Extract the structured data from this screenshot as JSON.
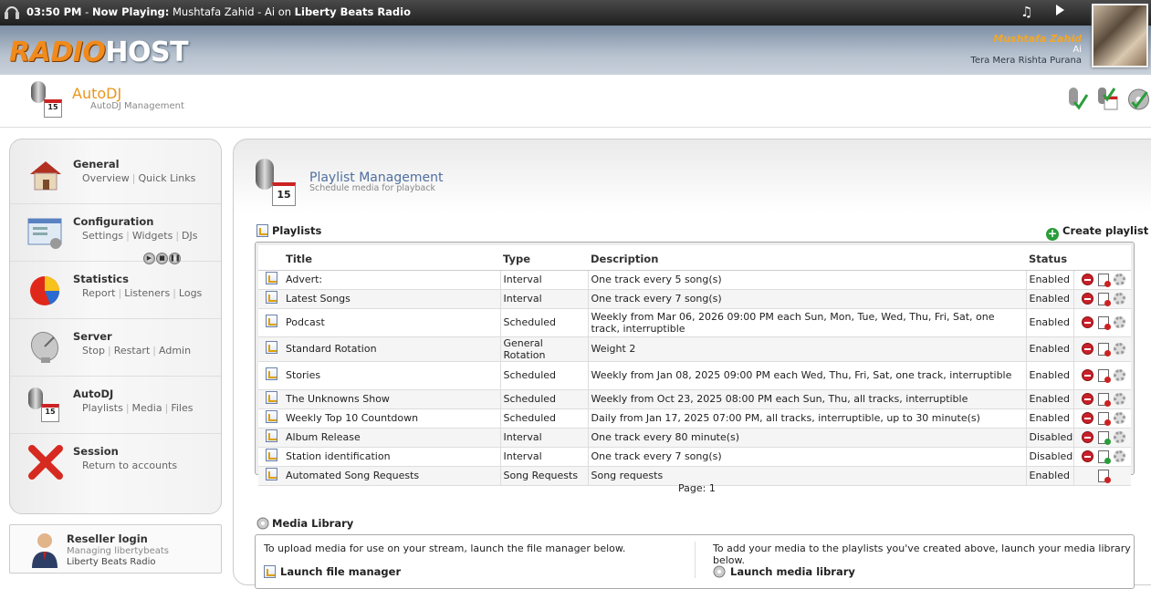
{
  "topbar": {
    "time": "03:50 PM",
    "now_playing_label": "Now Playing:",
    "track": "Mushtafa Zahid - Ai",
    "on": "on",
    "station": "Liberty Beats Radio"
  },
  "brand": {
    "part1": "RADIO",
    "part2": "HOST"
  },
  "now_playing": {
    "artist": "Mushtafa Zahid",
    "title": "Ai",
    "album": "Tera Mera Rishta Purana"
  },
  "page": {
    "title": "AutoDJ",
    "subtitle": "AutoDJ Management"
  },
  "sidebar": {
    "items": [
      {
        "title": "General",
        "links": [
          "Overview",
          "Quick Links"
        ]
      },
      {
        "title": "Configuration",
        "links": [
          "Settings",
          "Widgets",
          "DJs"
        ]
      },
      {
        "title": "Statistics",
        "links": [
          "Report",
          "Listeners",
          "Logs"
        ]
      },
      {
        "title": "Server",
        "links": [
          "Stop",
          "Restart",
          "Admin"
        ]
      },
      {
        "title": "AutoDJ",
        "links": [
          "Playlists",
          "Media",
          "Files"
        ]
      },
      {
        "title": "Session",
        "links": [
          "Return to accounts"
        ]
      }
    ],
    "reseller": {
      "title": "Reseller login",
      "managing": "Managing libertybeats",
      "station": "Liberty Beats Radio"
    }
  },
  "main": {
    "title": "Playlist Management",
    "subtitle": "Schedule media for playback",
    "playlists_heading": "Playlists",
    "create_label": "Create playlist",
    "columns": [
      "Title",
      "Type",
      "Description",
      "Status"
    ],
    "rows": [
      {
        "title": "Advert:",
        "type": "Interval",
        "description": "One track every 5 song(s)",
        "status": "Enabled"
      },
      {
        "title": "Latest Songs",
        "type": "Interval",
        "description": "One track every 7 song(s)",
        "status": "Enabled"
      },
      {
        "title": "Podcast",
        "type": "Scheduled",
        "description": "Weekly from Mar 06, 2026 09:00 PM each Sun, Mon, Tue, Wed, Thu, Fri, Sat, one track, interruptible",
        "status": "Enabled"
      },
      {
        "title": "Standard Rotation",
        "type": "General Rotation",
        "description": "Weight 2",
        "status": "Enabled"
      },
      {
        "title": "Stories",
        "type": "Scheduled",
        "description": "Weekly from Jan 08, 2025 09:00 PM each Wed, Thu, Fri, Sat, one track, interruptible",
        "status": "Enabled"
      },
      {
        "title": "The Unknowns Show",
        "type": "Scheduled",
        "description": "Weekly from Oct 23, 2025 08:00 PM each Sun, Thu, all tracks, interruptible",
        "status": "Enabled"
      },
      {
        "title": "Weekly Top 10 Countdown",
        "type": "Scheduled",
        "description": "Daily from Jan 17, 2025 07:00 PM, all tracks, interruptible, up to 30 minute(s)",
        "status": "Enabled"
      },
      {
        "title": "Album Release",
        "type": "Interval",
        "description": "One track every 80 minute(s)",
        "status": "Disabled"
      },
      {
        "title": "Station identification",
        "type": "Interval",
        "description": "One track every 7 song(s)",
        "status": "Disabled"
      },
      {
        "title": "Automated Song Requests",
        "type": "Song Requests",
        "description": "Song requests",
        "status": "Enabled"
      }
    ],
    "pager": "Page: 1",
    "media_library": {
      "heading": "Media Library",
      "left_text": "To upload media for use on your stream, launch the file manager below.",
      "right_text": "To add your media to the playlists you've created above, launch your media library below.",
      "left_link": "Launch file manager",
      "right_link": "Launch media library"
    }
  },
  "colors": {
    "accent": "#f08a1c",
    "title_blue": "#4f6f9f",
    "enabled_green": "#2a9d3b",
    "delete_red": "#c8202a"
  }
}
